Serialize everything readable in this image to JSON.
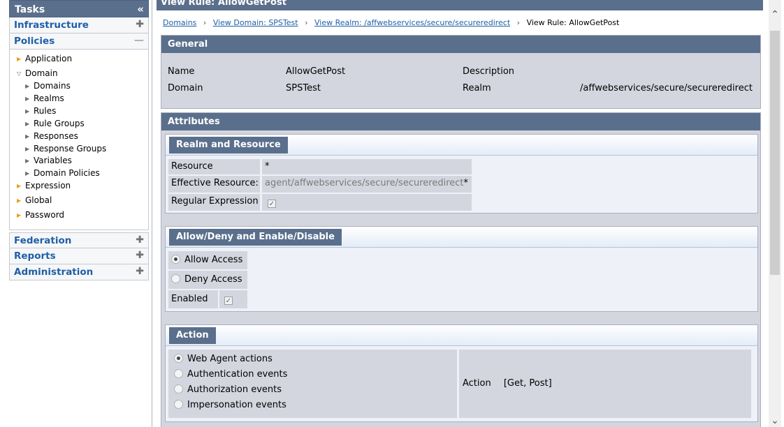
{
  "tasks": {
    "title": "Tasks",
    "collapse_icon": "«",
    "categories": {
      "infrastructure": "Infrastructure",
      "policies": "Policies",
      "federation": "Federation",
      "reports": "Reports",
      "administration": "Administration"
    },
    "expand_icon": "✚",
    "collapse_cat_icon": "—",
    "tree": {
      "application": "Application",
      "domain": "Domain",
      "domains": "Domains",
      "realms": "Realms",
      "rules": "Rules",
      "rule_groups": "Rule Groups",
      "responses": "Responses",
      "response_groups": "Response Groups",
      "variables": "Variables",
      "domain_policies": "Domain Policies",
      "expression": "Expression",
      "global": "Global",
      "password": "Password"
    }
  },
  "main": {
    "title": "View Rule: AllowGetPost",
    "breadcrumb": {
      "domains": "Domains",
      "domain": "View Domain: SPSTest",
      "realm": "View Realm: /affwebservices/secure/secureredirect",
      "current": "View Rule: AllowGetPost",
      "separator": "›"
    },
    "general": {
      "heading": "General",
      "name_label": "Name",
      "name_value": "AllowGetPost",
      "description_label": "Description",
      "domain_label": "Domain",
      "domain_value": "SPSTest",
      "realm_label": "Realm",
      "realm_value": "/affwebservices/secure/secureredirect"
    },
    "attributes": {
      "heading": "Attributes",
      "realm_resource": {
        "heading": "Realm and Resource",
        "resource_label": "Resource",
        "resource_value": "*",
        "effective_label": "Effective Resource:",
        "effective_value": "agent/affwebservices/secure/secureredirect",
        "effective_suffix": "*",
        "regex_label": "Regular Expression",
        "regex_checked": true
      },
      "allow_deny": {
        "heading": "Allow/Deny and Enable/Disable",
        "allow_label": "Allow Access",
        "deny_label": "Deny Access",
        "enabled_label": "Enabled",
        "selected": "allow",
        "enabled_checked": true
      },
      "action": {
        "heading": "Action",
        "options": [
          "Web Agent actions",
          "Authentication events",
          "Authorization events",
          "Impersonation events"
        ],
        "selected_index": 0,
        "action_label": "Action",
        "action_value": "[Get, Post]"
      }
    }
  },
  "icons": {
    "checkmark": "✓",
    "scroll_up": "⌃",
    "scroll_down": "⌄"
  }
}
